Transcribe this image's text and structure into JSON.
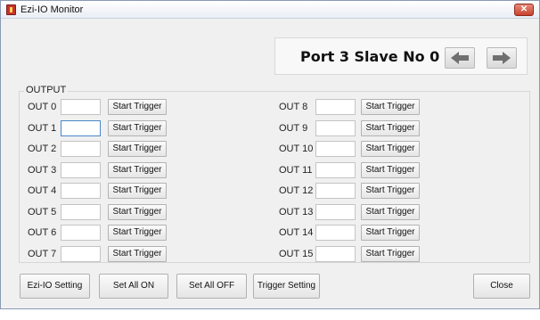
{
  "window": {
    "title": "Ezi-IO Monitor",
    "close_glyph": "✕"
  },
  "port": {
    "label": "Port 3 Slave No 0",
    "prev_icon": "arrow-left-icon",
    "next_icon": "arrow-right-icon"
  },
  "output": {
    "group_label": "OUTPUT",
    "trigger_label": "Start Trigger",
    "left": [
      {
        "label": "OUT 0",
        "value": ""
      },
      {
        "label": "OUT 1",
        "value": ""
      },
      {
        "label": "OUT 2",
        "value": ""
      },
      {
        "label": "OUT 3",
        "value": ""
      },
      {
        "label": "OUT 4",
        "value": ""
      },
      {
        "label": "OUT 5",
        "value": ""
      },
      {
        "label": "OUT 6",
        "value": ""
      },
      {
        "label": "OUT 7",
        "value": ""
      }
    ],
    "right": [
      {
        "label": "OUT 8",
        "value": ""
      },
      {
        "label": "OUT 9",
        "value": ""
      },
      {
        "label": "OUT 10",
        "value": ""
      },
      {
        "label": "OUT 11",
        "value": ""
      },
      {
        "label": "OUT 12",
        "value": ""
      },
      {
        "label": "OUT 13",
        "value": ""
      },
      {
        "label": "OUT 14",
        "value": ""
      },
      {
        "label": "OUT 15",
        "value": ""
      }
    ]
  },
  "buttons": {
    "ezi_io_setting": "Ezi-IO Setting",
    "set_all_on": "Set All ON",
    "set_all_off": "Set All OFF",
    "trigger_setting": "Trigger Setting",
    "close": "Close"
  },
  "colors": {
    "arrow": "#6f6f6f",
    "focus_border": "#4a86c8"
  }
}
